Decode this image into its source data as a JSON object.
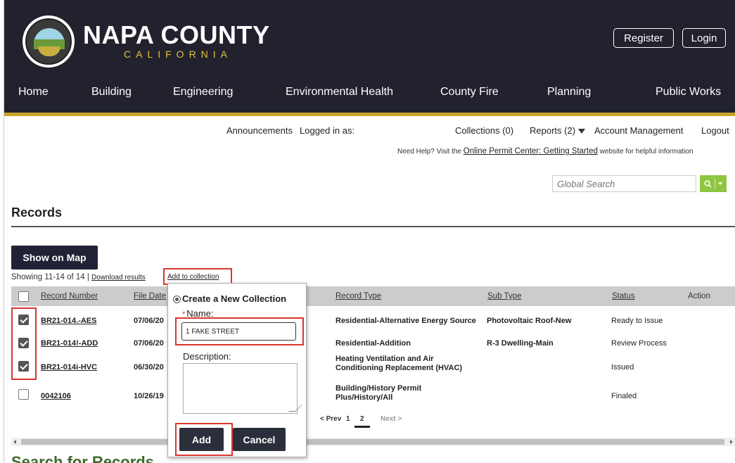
{
  "header": {
    "brand_title": "NAPA COUNTY",
    "brand_subtitle": "CALIFORNIA",
    "seal_text": "NAPA COUNTY CALIFORNIA",
    "register_label": "Register",
    "login_label": "Login"
  },
  "nav": {
    "items": [
      {
        "label": "Home"
      },
      {
        "label": "Building"
      },
      {
        "label": "Engineering"
      },
      {
        "label": "Environmental Health"
      },
      {
        "label": "County Fire"
      },
      {
        "label": "Planning"
      },
      {
        "label": "Public Works"
      }
    ]
  },
  "utility": {
    "announcements": "Announcements",
    "logged_in": "Logged in as:",
    "collections": "Collections (0)",
    "reports": "Reports (2)",
    "account": "Account Management",
    "logout": "Logout",
    "help_prefix": "Need Help? Visit the",
    "help_link": "Online Permit Center: Getting Started",
    "help_suffix": "website for helpful information"
  },
  "search": {
    "placeholder": "Global Search"
  },
  "records": {
    "title": "Records",
    "show_on_map": "Show on Map",
    "showing": "Showing 11-14 of 14",
    "separator": "|",
    "download": "Download results",
    "add_to_collection": "Add to collection",
    "columns": {
      "record_number": "Record Number",
      "file_date": "File Date",
      "record_type": "Record Type",
      "sub_type": "Sub Type",
      "status": "Status",
      "action": "Action"
    },
    "rows": [
      {
        "checked": true,
        "number": "BR21-014.-AES",
        "date": "07/06/20",
        "type": "Residential-Alternative Energy Source",
        "sub_type": "Photovoltaic Roof-New",
        "status": "Ready to Issue"
      },
      {
        "checked": true,
        "number": "BR21-014!-ADD",
        "date": "07/06/20",
        "type": "Residential-Addition",
        "sub_type": "R-3 Dwelling-Main",
        "status": "Review Process"
      },
      {
        "checked": true,
        "number": "BR21-014i-HVC",
        "date": "06/30/20",
        "type": "Heating Ventilation and Air Conditioning Replacement (HVAC)",
        "sub_type": "",
        "status": "Issued"
      },
      {
        "checked": false,
        "number": "0042106",
        "date": "10/26/19",
        "type": "Building/History Permit Plus/History/All",
        "sub_type": "",
        "status": "Finaled"
      }
    ],
    "pager": {
      "prev": "< Prev",
      "page1": "1",
      "page2": "2",
      "next": "Next >"
    }
  },
  "popup": {
    "title": "Create a New Collection",
    "name_required_mark": "*",
    "name_label": "Name:",
    "name_value": "1 FAKE STREET",
    "description_label": "Description:",
    "add_label": "Add",
    "cancel_label": "Cancel"
  },
  "bottom_heading": "Search for Records",
  "colors": {
    "header_bg": "#22222e",
    "gold": "#c9a227",
    "search_green": "#8dc63f",
    "highlight_red": "#d9352f",
    "button_dark": "#2b2f3c"
  }
}
